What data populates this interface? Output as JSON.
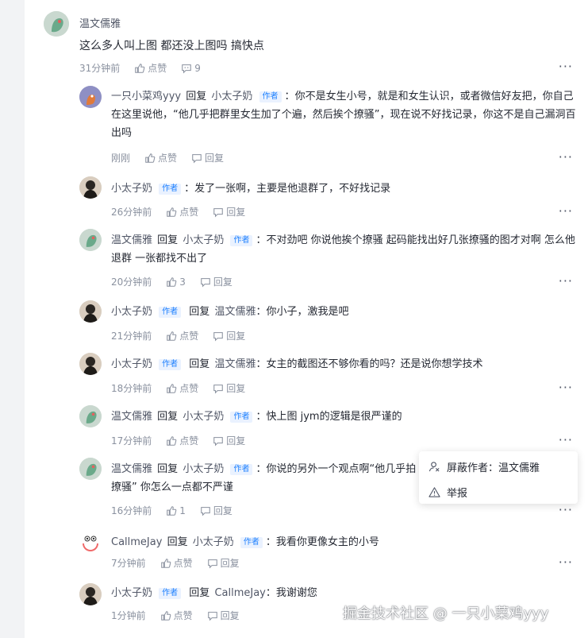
{
  "top_comment": {
    "author": "温文儒雅",
    "content": "这么多人叫上图 都还没上图吗 搞快点",
    "time": "31分钟前",
    "like_label": "点赞",
    "reply_count": "9"
  },
  "labels": {
    "author_tag": "作者",
    "reply_word": "回复",
    "like": "点赞",
    "reply": "回复",
    "more": "···"
  },
  "replies": [
    {
      "author": "一只小菜鸡yyy",
      "target": "小太子奶",
      "text": "你不是女生小号，就是和女生认识，或者微信好友把，你自己在这里说他，“他几乎把群里女生加了个遍，然后挨个撩骚”，现在说不好找记录，你这不是自己漏洞百出吗",
      "time": "刚刚",
      "likes": "点赞"
    },
    {
      "author": "小太子奶",
      "text": "发了一张啊，主要是他退群了，不好找记录",
      "time": "26分钟前",
      "likes": "点赞"
    },
    {
      "author": "温文儒雅",
      "target": "小太子奶",
      "text": "不对劲吧 你说他挨个撩骚 起码能找出好几张撩骚的图才对啊 怎么他退群 一张都找不出了",
      "time": "20分钟前",
      "likes": "3"
    },
    {
      "author": "小太子奶",
      "target": "温文儒雅",
      "text": "你小子，激我是吧",
      "time": "21分钟前",
      "likes": "点赞"
    },
    {
      "author": "小太子奶",
      "target": "温文儒雅",
      "text": "女主的截图还不够你看的吗？还是说你想学技术",
      "time": "18分钟前",
      "likes": "点赞"
    },
    {
      "author": "温文儒雅",
      "target": "小太子奶",
      "text": "快上图 jym的逻辑是很严谨的",
      "time": "17分钟前",
      "likes": "点赞"
    },
    {
      "author": "温文儒雅",
      "target": "小太子奶",
      "text": "你说的另外一个观点啊“他几乎拍",
      "text2": "撩骚” 你怎么一点都不严谨",
      "time": "16分钟前",
      "likes": "1"
    },
    {
      "author": "CallmeJay",
      "target": "小太子奶",
      "text": "我看你更像女主的小号",
      "time": "7分钟前",
      "likes": "点赞"
    },
    {
      "author": "小太子奶",
      "target": "CallmeJay",
      "text": "我谢谢您",
      "time": "1分钟前",
      "likes": "点赞"
    }
  ],
  "context_menu": {
    "block_author": "屏蔽作者：温文儒雅",
    "report": "举报"
  },
  "watermark": "掘金技术社区 @ 一只小菜鸡yyy",
  "colors": {
    "accent": "#1e80ff",
    "tag_bg": "#eaf2ff",
    "meta": "#8a919f"
  }
}
